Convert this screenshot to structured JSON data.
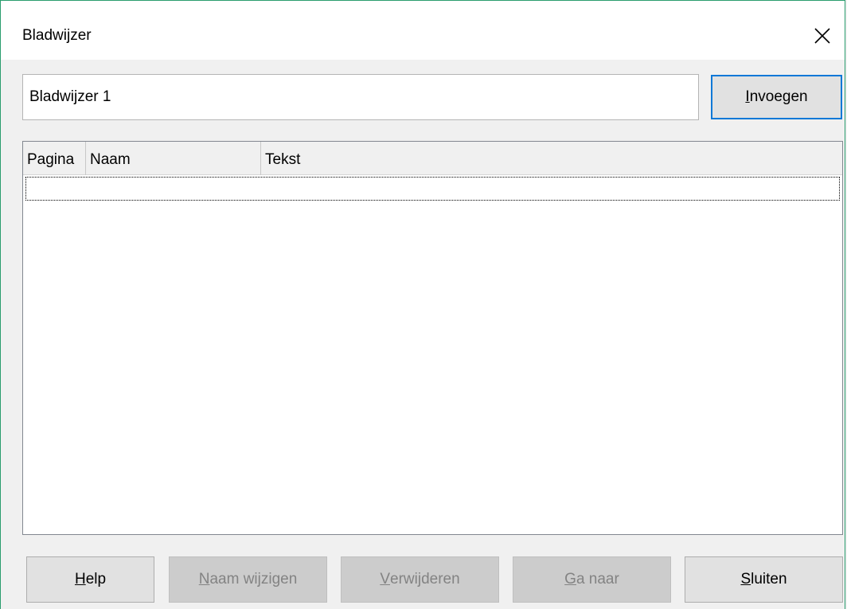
{
  "window": {
    "title": "Bladwijzer",
    "close_icon": "close-icon"
  },
  "name_input": {
    "value": "Bladwijzer 1"
  },
  "buttons": {
    "insert": {
      "prefix": "",
      "mnemonic": "I",
      "suffix": "nvoegen"
    },
    "help": {
      "prefix": "",
      "mnemonic": "H",
      "suffix": "elp"
    },
    "rename": {
      "prefix": "",
      "mnemonic": "N",
      "suffix": "aam wijzigen"
    },
    "delete": {
      "prefix": "",
      "mnemonic": "V",
      "suffix": "erwijderen"
    },
    "goto": {
      "prefix": "",
      "mnemonic": "G",
      "suffix": "a naar"
    },
    "close": {
      "prefix": "",
      "mnemonic": "S",
      "suffix": "luiten"
    }
  },
  "bookmark_list": {
    "columns": [
      "Pagina",
      "Naam",
      "Tekst"
    ],
    "rows": []
  },
  "colors": {
    "accent": "#0a78d7",
    "window_border": "#2a9d6e"
  }
}
